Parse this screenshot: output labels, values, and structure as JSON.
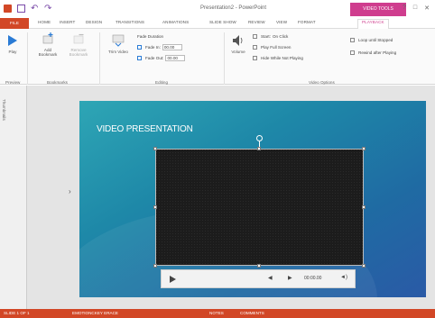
{
  "title_bar": {
    "document_title": "Presentation2 - PowerPoint",
    "context_tab_title": "VIDEO TOOLS",
    "window_controls": [
      "?",
      "□",
      "✕"
    ]
  },
  "tabs": [
    {
      "label": "FILE",
      "active": false
    },
    {
      "label": "HOME",
      "active": false
    },
    {
      "label": "INSERT",
      "active": false
    },
    {
      "label": "DESIGN",
      "active": false
    },
    {
      "label": "TRANSITIONS",
      "active": false
    },
    {
      "label": "ANIMATIONS",
      "active": false
    },
    {
      "label": "SLIDE SHOW",
      "active": false
    },
    {
      "label": "REVIEW",
      "active": false
    },
    {
      "label": "VIEW",
      "active": false
    },
    {
      "label": "FORMAT",
      "active": false
    },
    {
      "label": "PLAYBACK",
      "active": true
    }
  ],
  "ribbon": {
    "preview": {
      "play_label": "Play",
      "group": "Preview"
    },
    "bookmarks": {
      "add_label": "Add Bookmark",
      "remove_label": "Remove Bookmark",
      "group": "Bookmarks"
    },
    "editing": {
      "trim_label": "Trim Video",
      "fade_duration_label": "Fade Duration",
      "fade_in_label": "Fade In:",
      "fade_in_value": "00.00",
      "fade_out_label": "Fade Out:",
      "fade_out_value": "00.00",
      "group": "Editing"
    },
    "video_options": {
      "volume_label": "Volume",
      "start_label": "Start:",
      "start_value": "On Click",
      "play_full_screen": "Play Full Screen",
      "hide_while_not_playing": "Hide While Not Playing",
      "loop_until_stopped": "Loop until Stopped",
      "rewind_after_playing": "Rewind after Playing",
      "group": "Video Options"
    }
  },
  "thumbnail_pane": {
    "label": "Thumbnails"
  },
  "slide": {
    "title": "VIDEO PRESENTATION"
  },
  "media_controls": {
    "time": "00:00.00"
  },
  "status_bar": {
    "slide_info": "SLIDE 1 OF 1",
    "theme": "EMOTIONCKEY ERACE",
    "notes": "NOTES",
    "comments": "COMMENTS"
  },
  "colors": {
    "accent": "#d24726",
    "context": "#cf3d8e"
  }
}
